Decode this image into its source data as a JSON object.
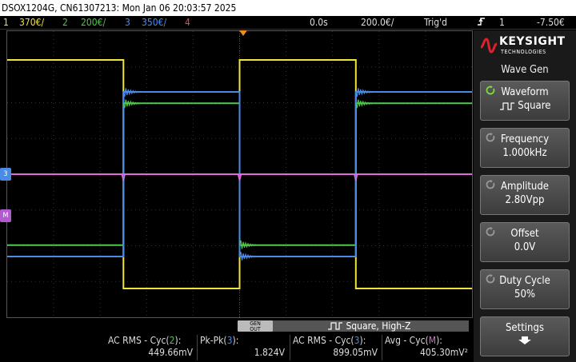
{
  "title": "DSOX1204G, CN61307213: Mon Jan 06 20:03:57 2025",
  "status": {
    "channels": [
      {
        "num": "1",
        "scale": "370€/",
        "color": "#f2e23a"
      },
      {
        "num": "2",
        "scale": "200€/",
        "color": "#4ec94a"
      },
      {
        "num": "3",
        "scale": "350€/",
        "color": "#4a8be8"
      },
      {
        "num": "4",
        "color": "#e84a4a"
      }
    ],
    "time_delay": "0.0s",
    "time_scale": "200.0€/",
    "trigger_mode": "Trig'd",
    "trigger_channel": "1",
    "trigger_level": "-7.50€"
  },
  "panel": {
    "brand": "KEYSIGHT",
    "brand_sub": "TECHNOLOGIES",
    "menu_title": "Wave Gen",
    "softkeys": [
      {
        "label": "Waveform",
        "value": "Square",
        "active": true
      },
      {
        "label": "Frequency",
        "value": "1.000kHz"
      },
      {
        "label": "Amplitude",
        "value": "2.80Vpp"
      },
      {
        "label": "Offset",
        "value": "0.0V"
      },
      {
        "label": "Duty Cycle",
        "value": "50%"
      },
      {
        "label": "Settings",
        "value": ""
      }
    ]
  },
  "wavegen": {
    "tag_top": "GEN",
    "tag_bottom": "OUT",
    "info": "Square, High-Z"
  },
  "measurements": [
    {
      "prefix": "AC RMS - Cyc(",
      "ch": "2",
      "suffix": "):",
      "value": "449.66mV",
      "color": "#4ec94a"
    },
    {
      "prefix": "Pk-Pk(",
      "ch": "3",
      "suffix": "):",
      "value": "1.824V",
      "color": "#4a8be8"
    },
    {
      "prefix": "AC RMS - Cyc(",
      "ch": "3",
      "suffix": "):",
      "value": "899.05mV",
      "color": "#4a8be8"
    },
    {
      "prefix": "Avg - Cyc(",
      "ch": "M",
      "suffix": "):",
      "value": "405.30mV²",
      "color": "#d46ad4"
    }
  ],
  "ground_markers": [
    {
      "text": "3"
    },
    {
      "text": "M"
    }
  ],
  "chart_data": {
    "type": "line",
    "x_unit": "s",
    "time_per_div": 0.0002,
    "divisions_x": 10,
    "series": [
      {
        "color": "#f2e23a",
        "points": [
          [
            -0.001,
            1.0
          ],
          [
            -0.0005,
            1.0
          ],
          [
            -0.0005,
            -1.0
          ],
          [
            0.0,
            -1.0
          ],
          [
            0.0,
            1.0
          ],
          [
            0.0005,
            1.0
          ],
          [
            0.0005,
            -1.0
          ],
          [
            0.001,
            -1.0
          ]
        ]
      },
      {
        "color": "#4ec94a",
        "points": [
          [
            -0.001,
            -0.62
          ],
          [
            -0.0005,
            -0.62
          ],
          [
            -0.0005,
            0.62
          ],
          [
            0.0,
            0.62
          ],
          [
            0.0,
            -0.62
          ],
          [
            0.0005,
            -0.62
          ],
          [
            0.0005,
            0.62
          ],
          [
            0.001,
            0.62
          ]
        ]
      },
      {
        "color": "#4a8be8",
        "points": [
          [
            -0.001,
            -0.72
          ],
          [
            -0.0005,
            -0.72
          ],
          [
            -0.0005,
            0.72
          ],
          [
            0.0,
            0.72
          ],
          [
            0.0,
            -0.72
          ],
          [
            0.0005,
            -0.72
          ],
          [
            0.0005,
            0.72
          ],
          [
            0.001,
            0.72
          ]
        ]
      },
      {
        "color": "#e46ad8",
        "points": [
          [
            -0.001,
            0.0
          ],
          [
            0.001,
            0.0
          ]
        ]
      }
    ]
  }
}
